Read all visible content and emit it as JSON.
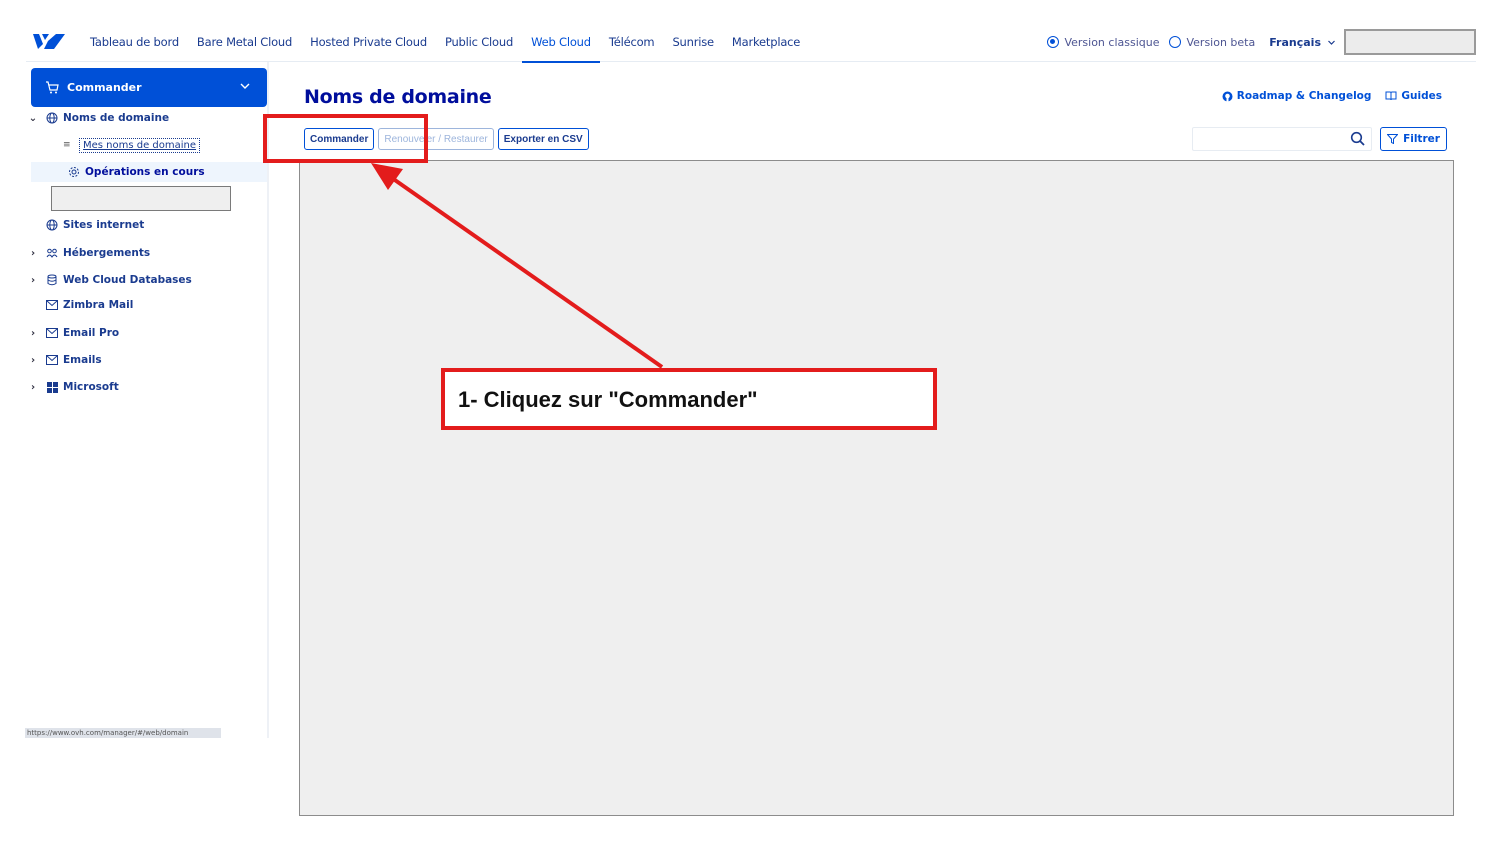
{
  "topnav": {
    "links": [
      "Tableau de bord",
      "Bare Metal Cloud",
      "Hosted Private Cloud",
      "Public Cloud",
      "Web Cloud",
      "Télécom",
      "Sunrise",
      "Marketplace"
    ],
    "active": "Web Cloud",
    "version_classic": "Version classique",
    "version_beta": "Version beta",
    "language": "Français",
    "logo_icon": "ovh-logo-icon"
  },
  "sidebar": {
    "order_button": "Commander",
    "domains": "Noms de domaine",
    "my_domains": "Mes noms de domaine",
    "operations": "Opérations en cours",
    "websites": "Sites internet",
    "hosting": "Hébergements",
    "databases": "Web Cloud Databases",
    "zimbra": "Zimbra Mail",
    "email_pro": "Email Pro",
    "emails": "Emails",
    "microsoft": "Microsoft",
    "status_url": "https://www.ovh.com/manager/#/web/domain"
  },
  "main": {
    "title": "Noms de domaine",
    "roadmap": "Roadmap & Changelog",
    "guides": "Guides",
    "btn_order": "Commander",
    "btn_renew": "Renouveler / Restaurer",
    "btn_export": "Exporter en CSV",
    "search_placeholder": "",
    "filter": "Filtrer"
  },
  "annotation": {
    "callout": "1- Cliquez sur \"Commander\"",
    "color": "#e31c1c"
  },
  "colors": {
    "primary": "#0050d7",
    "navy": "#000e9c"
  }
}
